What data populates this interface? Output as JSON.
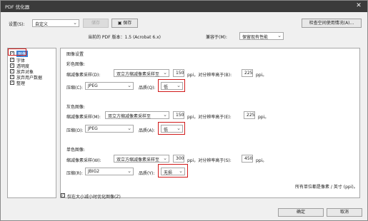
{
  "window": {
    "title": "PDF 优化器",
    "close_glyph": "✕"
  },
  "toolbar": {
    "settings_label": "设置(S):",
    "settings_value": "自定义",
    "save_label": "储存",
    "save_as_label": "保存",
    "audit_button": "检查空间使用情况(A)..."
  },
  "compat": {
    "current_label": "当前的 PDF 版本：1.5 (Acrobat 6.x)",
    "keep_label": "兼容于(M):",
    "keep_value": "保留现有性能"
  },
  "sidebar": {
    "items": [
      {
        "label": "图像",
        "checked": true
      },
      {
        "label": "字体",
        "checked": true
      },
      {
        "label": "透明度",
        "checked": true
      },
      {
        "label": "放弃对象",
        "checked": true
      },
      {
        "label": "放弃用户数据",
        "checked": true
      },
      {
        "label": "整理",
        "checked": true
      }
    ]
  },
  "images": {
    "section_title": "图像设置",
    "color": {
      "heading": "彩色图像:",
      "downsample_label": "缩减像素采样(D):",
      "downsample_value": "双立方缩减像素采样至",
      "ppi_value": "150",
      "ppi_unit": "ppi，对分辨率高于(B):",
      "above_value": "225",
      "above_unit": "ppi。",
      "compression_label": "压缩(C):",
      "compression_value": "JPEG",
      "quality_label": "品质(Q):",
      "quality_value": "低"
    },
    "gray": {
      "heading": "灰色图像:",
      "downsample_label": "缩减像素采样(M):",
      "downsample_value": "双立方缩减像素采样至",
      "ppi_value": "150",
      "ppi_unit": "ppi，对分辨率高于(E):",
      "above_value": "225",
      "above_unit": "ppi。",
      "compression_label": "压缩(O):",
      "compression_value": "JPEG",
      "quality_label": "品质(A):",
      "quality_value": "低"
    },
    "mono": {
      "heading": "单色图像:",
      "downsample_label": "缩减像素采样(W):",
      "downsample_value": "双立方缩减像素采样至",
      "ppi_value": "300",
      "ppi_unit": "ppi，对分辨率高于(S):",
      "above_value": "450",
      "above_unit": "ppi。",
      "compression_label": "压缩(R):",
      "compression_value": "JBIG2",
      "quality_label": "品质(Y):",
      "quality_value": "无损"
    },
    "footer_note": "所有单位都是像素 / 英寸 (ppi)。"
  },
  "footer": {
    "only_if_smaller_label": "仅在大小减小时优化图像(Z)",
    "ok_label": "确定",
    "cancel_label": "取消"
  }
}
